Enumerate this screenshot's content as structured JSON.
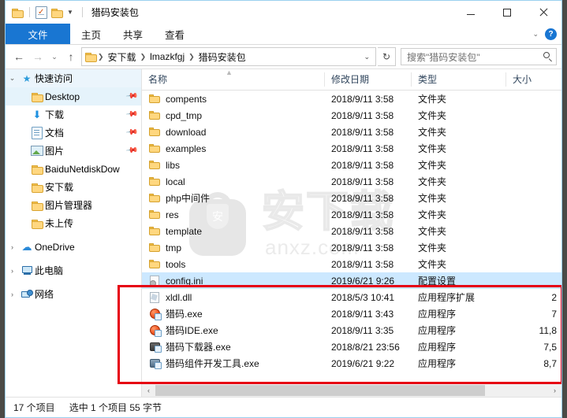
{
  "window": {
    "title": "猎码安装包",
    "quick_access": [
      {
        "name": "folder-icon",
        "label": "文件夹"
      },
      {
        "name": "properties-icon",
        "label": "属性"
      },
      {
        "name": "new-folder-icon",
        "label": "新建文件夹"
      },
      {
        "name": "chevron-down-icon",
        "label": "自定义快速访问工具栏"
      }
    ],
    "controls": {
      "minimize": "—",
      "maximize": "□",
      "close": "✕"
    }
  },
  "ribbon": {
    "tabs": [
      {
        "label": "文件",
        "active": true
      },
      {
        "label": "主页",
        "active": false
      },
      {
        "label": "共享",
        "active": false
      },
      {
        "label": "查看",
        "active": false
      }
    ],
    "collapse_icon": "chevron-down-icon",
    "help_label": "?"
  },
  "address": {
    "back": "←",
    "forward": "→",
    "recent": "⌄",
    "up": "↑",
    "crumbs": [
      "安下载",
      "lmazkfgj",
      "猎码安装包"
    ],
    "dropdown": "⌄",
    "refresh": "↻",
    "search_placeholder": "搜索\"猎码安装包\""
  },
  "sidebar": {
    "items": [
      {
        "label": "快速访问",
        "icon": "star-pin-icon",
        "level": 1,
        "expander": "⌄",
        "header": true,
        "pinned": false
      },
      {
        "label": "Desktop",
        "icon": "folder-icon",
        "level": 2,
        "expander": "",
        "pinned": true
      },
      {
        "label": "下载",
        "icon": "download-icon",
        "level": 2,
        "expander": "",
        "pinned": true
      },
      {
        "label": "文档",
        "icon": "documents-icon",
        "level": 2,
        "expander": "",
        "pinned": true
      },
      {
        "label": "图片",
        "icon": "pictures-icon",
        "level": 2,
        "expander": "",
        "pinned": true
      },
      {
        "label": "BaiduNetdiskDow",
        "icon": "folder-icon",
        "level": 2,
        "expander": "",
        "pinned": false
      },
      {
        "label": "安下载",
        "icon": "folder-icon",
        "level": 2,
        "expander": "",
        "pinned": false
      },
      {
        "label": "图片管理器",
        "icon": "folder-icon",
        "level": 2,
        "expander": "",
        "pinned": false
      },
      {
        "label": "未上传",
        "icon": "folder-icon",
        "level": 2,
        "expander": "",
        "pinned": false
      },
      {
        "label": "OneDrive",
        "icon": "cloud-icon",
        "level": 1,
        "expander": "›",
        "pinned": false
      },
      {
        "label": "此电脑",
        "icon": "this-pc-icon",
        "level": 1,
        "expander": "›",
        "pinned": false
      },
      {
        "label": "网络",
        "icon": "network-icon",
        "level": 1,
        "expander": "›",
        "pinned": false
      }
    ]
  },
  "filelist": {
    "columns": [
      {
        "label": "名称",
        "key": "name"
      },
      {
        "label": "修改日期",
        "key": "date"
      },
      {
        "label": "类型",
        "key": "type"
      },
      {
        "label": "大小",
        "key": "size"
      }
    ],
    "sort": {
      "column": "名称",
      "direction": "asc",
      "icon": "caret-up-icon"
    },
    "rows": [
      {
        "name": "compents",
        "date": "2018/9/11 3:58",
        "type": "文件夹",
        "size": "",
        "icon": "folder-icon",
        "selected": false
      },
      {
        "name": "cpd_tmp",
        "date": "2018/9/11 3:58",
        "type": "文件夹",
        "size": "",
        "icon": "folder-icon",
        "selected": false
      },
      {
        "name": "download",
        "date": "2018/9/11 3:58",
        "type": "文件夹",
        "size": "",
        "icon": "folder-icon",
        "selected": false
      },
      {
        "name": "examples",
        "date": "2018/9/11 3:58",
        "type": "文件夹",
        "size": "",
        "icon": "folder-icon",
        "selected": false
      },
      {
        "name": "libs",
        "date": "2018/9/11 3:58",
        "type": "文件夹",
        "size": "",
        "icon": "folder-icon",
        "selected": false
      },
      {
        "name": "local",
        "date": "2018/9/11 3:58",
        "type": "文件夹",
        "size": "",
        "icon": "folder-icon",
        "selected": false
      },
      {
        "name": "php中间件",
        "date": "2018/9/11 3:58",
        "type": "文件夹",
        "size": "",
        "icon": "folder-icon",
        "selected": false
      },
      {
        "name": "res",
        "date": "2018/9/11 3:58",
        "type": "文件夹",
        "size": "",
        "icon": "folder-icon",
        "selected": false
      },
      {
        "name": "template",
        "date": "2018/9/11 3:58",
        "type": "文件夹",
        "size": "",
        "icon": "folder-icon",
        "selected": false
      },
      {
        "name": "tmp",
        "date": "2018/9/11 3:58",
        "type": "文件夹",
        "size": "",
        "icon": "folder-icon",
        "selected": false
      },
      {
        "name": "tools",
        "date": "2018/9/11 3:58",
        "type": "文件夹",
        "size": "",
        "icon": "folder-icon",
        "selected": false
      },
      {
        "name": "config.ini",
        "date": "2019/6/21 9:26",
        "type": "配置设置",
        "size": "",
        "icon": "config-file-icon",
        "selected": true
      },
      {
        "name": "xldl.dll",
        "date": "2018/5/3 10:41",
        "type": "应用程序扩展",
        "size": "2",
        "icon": "dll-file-icon",
        "selected": false
      },
      {
        "name": "猎码.exe",
        "date": "2018/9/11 3:43",
        "type": "应用程序",
        "size": "7",
        "icon": "lieama-app-icon",
        "selected": false
      },
      {
        "name": "猎码IDE.exe",
        "date": "2018/9/11 3:35",
        "type": "应用程序",
        "size": "11,8",
        "icon": "lieama-ide-icon",
        "selected": false
      },
      {
        "name": "猎码下载器.exe",
        "date": "2018/8/21 23:56",
        "type": "应用程序",
        "size": "7,5",
        "icon": "downloader-app-icon",
        "selected": false
      },
      {
        "name": "猎码组件开发工具.exe",
        "date": "2019/6/21 9:22",
        "type": "应用程序",
        "size": "8,7",
        "icon": "devtool-app-icon",
        "selected": false
      }
    ]
  },
  "watermark": {
    "brand": "安下载",
    "url": "anxz.com",
    "badge_char": "安"
  },
  "scrollbar": {
    "left_arrow": "‹",
    "right_arrow": "›"
  },
  "status": {
    "item_count": "17 个项目",
    "selection": "选中 1 个项目  55 字节"
  },
  "colors": {
    "accent": "#1976d2",
    "selection": "#cce8ff",
    "highlight_box": "#e60012",
    "folder": "#ffd77f"
  }
}
